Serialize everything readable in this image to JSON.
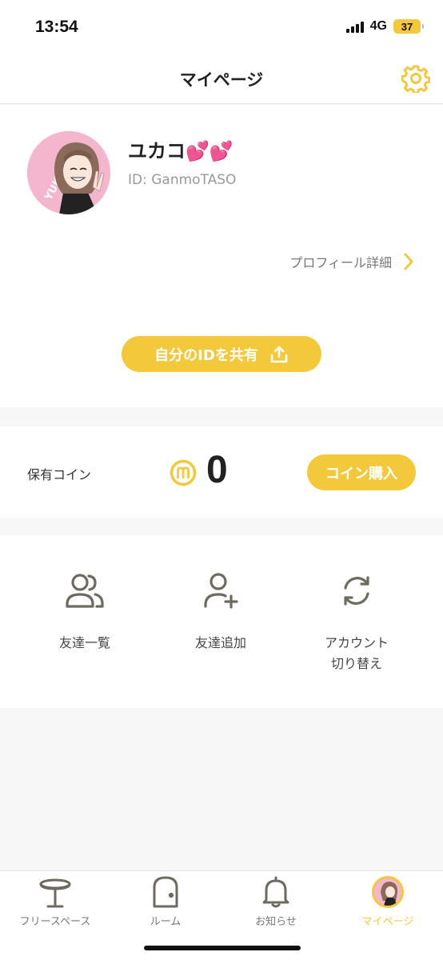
{
  "status_bar": {
    "time": "13:54",
    "network": "4G",
    "battery": "37"
  },
  "header": {
    "title": "マイページ"
  },
  "profile": {
    "name": "ユカコ💕💕",
    "id_text": "ID: GanmoTASO",
    "detail_link": "プロフィール詳細",
    "share_button": "自分のIDを共有",
    "avatar_text": "YUKACO"
  },
  "coins": {
    "label": "保有コイン",
    "count": "0",
    "buy_button": "コイン購入"
  },
  "actions": [
    {
      "label": "友達一覧",
      "icon": "friends-icon"
    },
    {
      "label": "友達追加",
      "icon": "add-friend-icon"
    },
    {
      "label": "アカウント\n切り替え",
      "icon": "switch-account-icon"
    }
  ],
  "tabs": [
    {
      "label": "フリースペース",
      "icon": "table-icon"
    },
    {
      "label": "ルーム",
      "icon": "door-icon"
    },
    {
      "label": "お知らせ",
      "icon": "bell-icon"
    },
    {
      "label": "マイページ",
      "icon": "avatar-icon",
      "active": true
    }
  ],
  "colors": {
    "accent": "#f3c93b",
    "text": "#333333",
    "muted": "#999999"
  }
}
